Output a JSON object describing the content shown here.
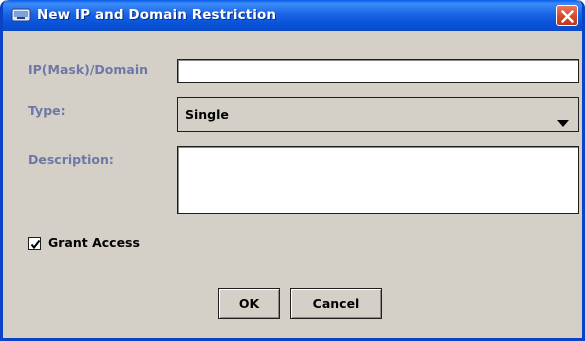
{
  "window": {
    "title": "New IP and Domain Restriction"
  },
  "form": {
    "ip_label": "IP(Mask)/Domain",
    "ip_value": "",
    "type_label": "Type:",
    "type_value": "Single",
    "description_label": "Description:",
    "description_value": "",
    "grant_access_label": "Grant Access",
    "grant_access_checked": true
  },
  "buttons": {
    "ok_label": "OK",
    "cancel_label": "Cancel"
  },
  "icons": {
    "title": "app-window-icon",
    "close": "close-icon",
    "dropdown": "chevron-down-icon",
    "check": "checkmark-icon"
  },
  "colors": {
    "titlebar": "#1b64e6",
    "dialog_bg": "#d4d0c8",
    "label": "#6e78a6",
    "close_button": "#d64b2a"
  }
}
